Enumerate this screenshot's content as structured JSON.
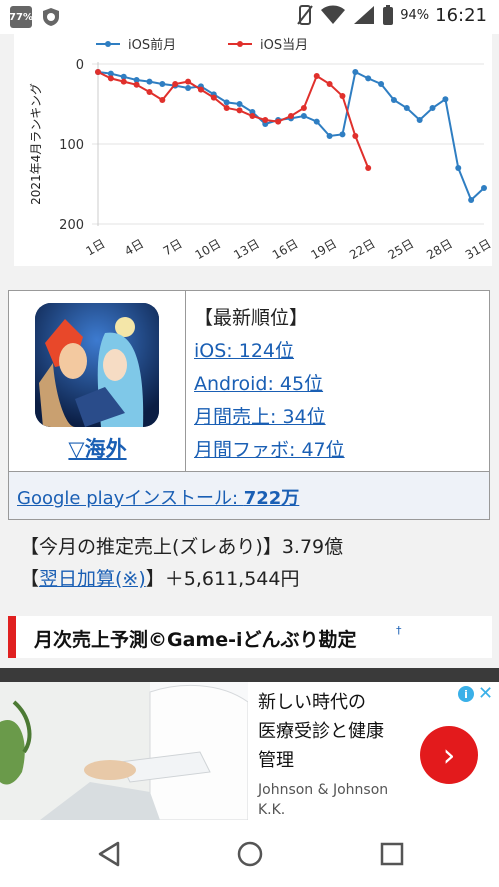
{
  "status_bar": {
    "battery_badge": "77%",
    "battery_percent": "94%",
    "time": "16:21",
    "icons": [
      "battery-saver-icon",
      "shield-icon",
      "vibrate-icon",
      "wifi-icon",
      "signal-icon",
      "battery-icon"
    ]
  },
  "chart_data": {
    "type": "line",
    "ylabel": "2021年4月ランキング",
    "ylim": [
      200,
      0
    ],
    "yticks": [
      "0",
      "100",
      "200"
    ],
    "xticks": [
      "1日",
      "4日",
      "7日",
      "10日",
      "13日",
      "16日",
      "19日",
      "22日",
      "25日",
      "28日",
      "31日"
    ],
    "legend": "top",
    "colors": {
      "prev": "#2f7ec2",
      "curr": "#e0302c"
    },
    "series": [
      {
        "name": "iOS前月",
        "x": [
          1,
          2,
          3,
          4,
          5,
          6,
          7,
          8,
          9,
          10,
          11,
          12,
          13,
          14,
          15,
          16,
          17,
          18,
          19,
          20,
          21,
          22,
          23,
          24,
          25,
          26,
          27,
          28,
          29,
          30,
          31
        ],
        "values": [
          10,
          12,
          16,
          20,
          22,
          25,
          27,
          30,
          28,
          38,
          48,
          50,
          60,
          75,
          70,
          68,
          65,
          72,
          90,
          88,
          10,
          18,
          25,
          45,
          55,
          70,
          55,
          44,
          130,
          170,
          155
        ]
      },
      {
        "name": "iOS当月",
        "x": [
          1,
          2,
          3,
          4,
          5,
          6,
          7,
          8,
          9,
          10,
          11,
          12,
          13,
          14,
          15,
          16,
          17,
          18,
          19,
          20,
          21,
          22
        ],
        "values": [
          10,
          18,
          22,
          26,
          35,
          45,
          25,
          22,
          32,
          42,
          55,
          58,
          65,
          70,
          72,
          65,
          55,
          15,
          25,
          40,
          90,
          130
        ]
      }
    ]
  },
  "game": {
    "icon": "game-app-icon",
    "region_link": "▽海外"
  },
  "ranking": {
    "title": "【最新順位】",
    "ios": "iOS: 124位",
    "android": "Android: 45位",
    "monthly_sales": "月間売上: 34位",
    "monthly_fav": "月間ファボ: 47位"
  },
  "install": {
    "label": "Google playインストール: ",
    "count": "722万"
  },
  "sales": {
    "line1": "【今月の推定売上(ズレあり)】3.79億",
    "line2_prefix": "【",
    "line2_link": "翌日加算(※)",
    "line2_suffix": "】＋5,611,544円"
  },
  "section": {
    "title": "月次売上予測©Game-iどんぶり勘定",
    "sup": "†"
  },
  "ad": {
    "title_lines": [
      "新しい時代の",
      "医療受診と健康",
      "管理"
    ],
    "sponsor_lines": [
      "Johnson & Johnson",
      "K.K."
    ],
    "button_glyph": "›",
    "info_glyph": "i",
    "close_glyph": "✕"
  },
  "nav": {
    "icons": [
      "back-icon",
      "home-icon",
      "recent-apps-icon"
    ]
  }
}
